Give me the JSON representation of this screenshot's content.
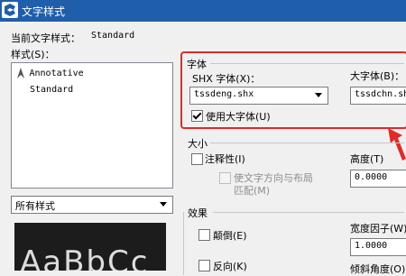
{
  "window": {
    "title": "文字样式"
  },
  "current_style": {
    "label": "当前文字样式：",
    "value": "Standard"
  },
  "styles": {
    "label": "样式(S)：",
    "items": [
      "Annotative",
      "Standard"
    ],
    "filter": {
      "value": "所有样式"
    }
  },
  "preview": {
    "text": "AaBbCc"
  },
  "font": {
    "group_label": "字体",
    "shx_label": "SHX 字体(X)：",
    "shx_value": "tssdeng.shx",
    "big_label": "大字体(B)：",
    "big_value": "tssdchn.shx",
    "use_big_font_label": "使用大字体(U)",
    "use_big_font_checked": true
  },
  "size": {
    "group_label": "大小",
    "annotative_label": "注释性(I)",
    "orientation_label_1": "使文字方向与布局",
    "orientation_label_2": "匹配(M)",
    "height_label": "高度(T)",
    "height_value": "0.0000"
  },
  "effects": {
    "group_label": "效果",
    "upside_down_label": "颠倒(E)",
    "backwards_label": "反向(K)",
    "width_factor_label": "宽度因子(W)：",
    "width_factor_value": "1.0000",
    "oblique_label": "倾斜角度(O)："
  },
  "colors": {
    "titlebar": "#1f5eab",
    "highlight": "#e02a2a"
  }
}
